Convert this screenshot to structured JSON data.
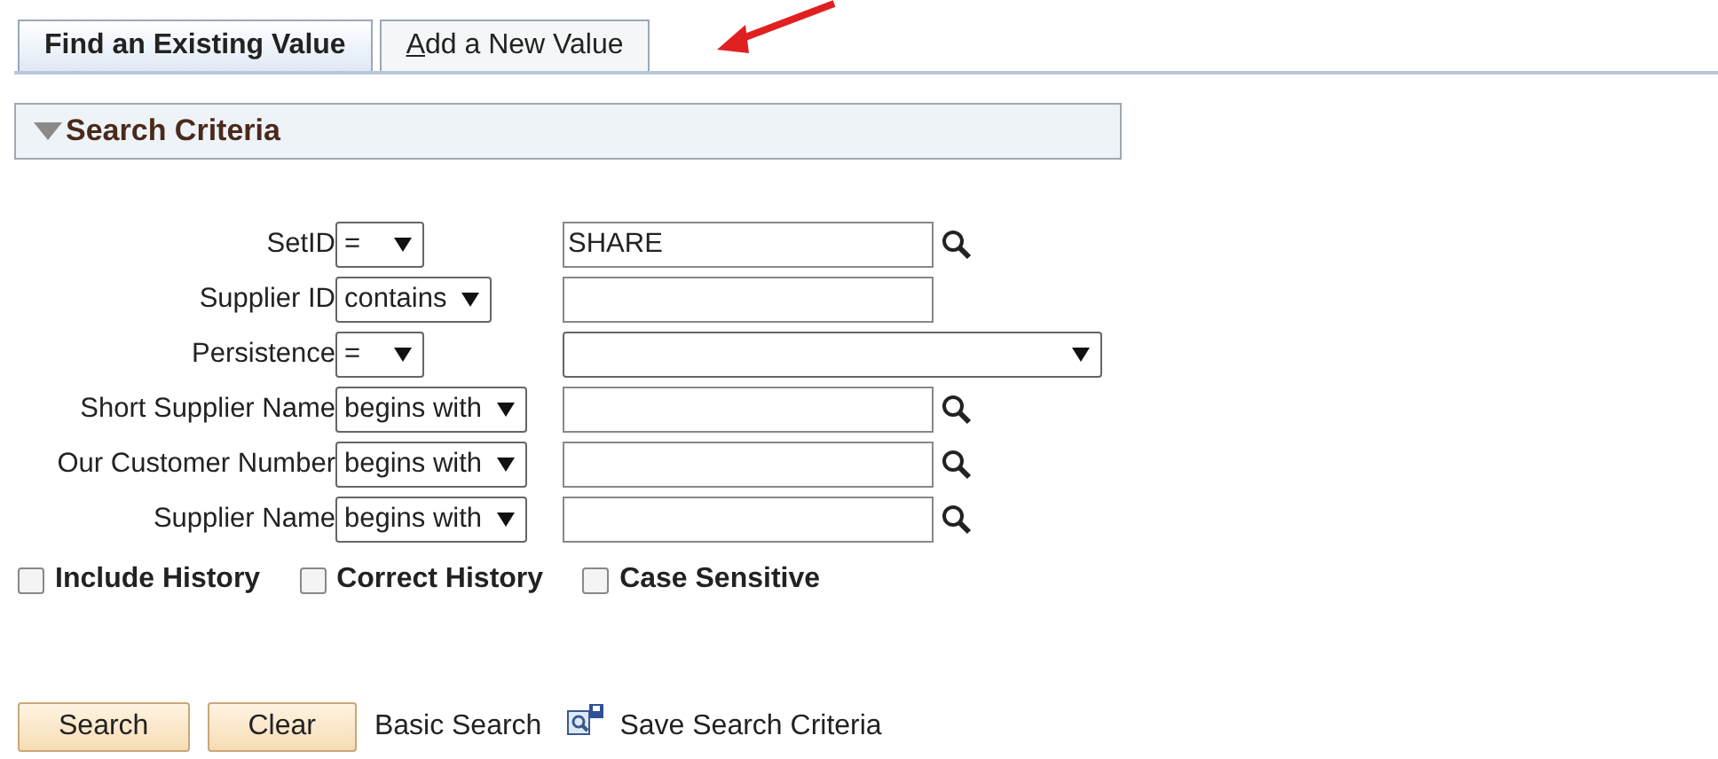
{
  "tabs": [
    {
      "label": "Find an Existing Value",
      "selected": true
    },
    {
      "label": "Add a New Value",
      "selected": false
    }
  ],
  "section": {
    "title": "Search Criteria",
    "expanded": true
  },
  "fields": [
    {
      "label": "SetID",
      "operator": "=",
      "kind": "text",
      "value": "SHARE",
      "lookup": true
    },
    {
      "label": "Supplier ID",
      "operator": "contains",
      "kind": "text",
      "lookup": false
    },
    {
      "label": "Persistence",
      "operator": "=",
      "kind": "select",
      "lookup": false
    },
    {
      "label": "Short Supplier Name",
      "operator": "begins with",
      "kind": "text",
      "lookup": true
    },
    {
      "label": "Our Customer Number",
      "operator": "begins with",
      "kind": "text",
      "lookup": true
    },
    {
      "label": "Supplier Name",
      "operator": "begins with",
      "kind": "text",
      "lookup": true
    }
  ],
  "options": [
    {
      "label": "Include History",
      "checked": false
    },
    {
      "label": "Correct History",
      "checked": false
    },
    {
      "label": "Case Sensitive",
      "checked": false
    }
  ],
  "buttons": [
    "Search",
    "Clear"
  ],
  "links": [
    {
      "label": "Basic Search",
      "icon": false
    },
    {
      "label": "Save Search Criteria",
      "icon": true
    }
  ]
}
